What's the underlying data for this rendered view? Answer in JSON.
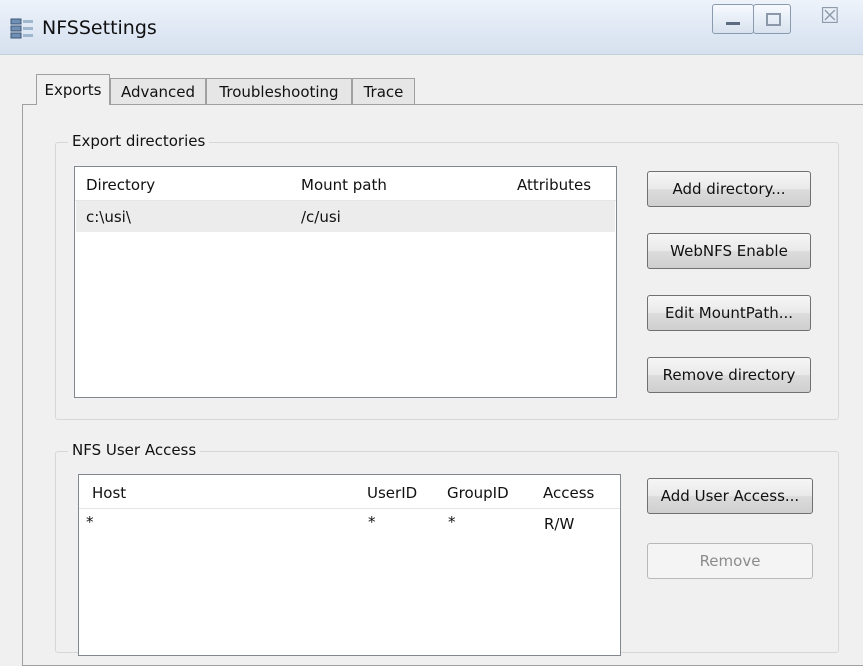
{
  "window": {
    "title": "NFSSettings"
  },
  "tabs": [
    {
      "label": "Exports",
      "active": true
    },
    {
      "label": "Advanced",
      "active": false
    },
    {
      "label": "Troubleshooting",
      "active": false
    },
    {
      "label": "Trace",
      "active": false
    }
  ],
  "export_directories": {
    "group_title": "Export directories",
    "columns": [
      "Directory",
      "Mount path",
      "Attributes"
    ],
    "rows": [
      {
        "directory": "c:\\usi\\",
        "mount_path": "/c/usi",
        "attributes": ""
      }
    ],
    "buttons": {
      "add": "Add directory...",
      "webnfs": "WebNFS Enable",
      "edit": "Edit MountPath...",
      "remove": "Remove directory"
    }
  },
  "user_access": {
    "group_title": "NFS User Access",
    "columns": [
      "Host",
      "UserID",
      "GroupID",
      "Access"
    ],
    "rows": [
      {
        "host": "*",
        "userid": "*",
        "groupid": "*",
        "access": "R/W"
      }
    ],
    "buttons": {
      "add": "Add User Access...",
      "remove": "Remove"
    }
  },
  "icons": {
    "app": "server-list-icon",
    "minimize": "minimize-icon",
    "maximize": "maximize-icon",
    "close": "close-icon"
  }
}
